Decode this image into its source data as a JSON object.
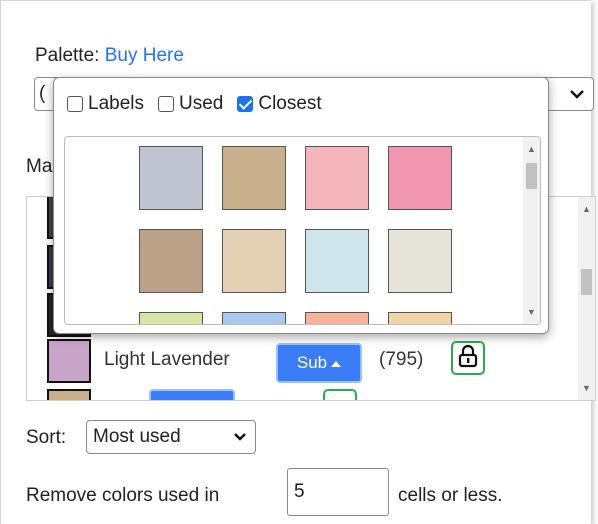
{
  "palette": {
    "label": "Palette:",
    "link_text": "Buy Here",
    "select_value": "("
  },
  "ma_label": "Ma",
  "used_colors": {
    "item": {
      "name": "Light Lavender",
      "sub_label": "Sub",
      "count": "(795)",
      "color": "#c8a4c8"
    },
    "partial_colors": [
      "#c8b08c",
      "#d8c4a6"
    ]
  },
  "sort": {
    "label": "Sort:",
    "value": "Most used"
  },
  "remove": {
    "prefix": "Remove colors used in",
    "value": "5",
    "suffix": "cells or less."
  },
  "popup": {
    "checkboxes": [
      {
        "label": "Labels",
        "checked": false
      },
      {
        "label": "Used",
        "checked": false
      },
      {
        "label": "Closest",
        "checked": true
      }
    ],
    "swatches": [
      {
        "color": "#c0c4d0"
      },
      {
        "color": "#c8b08c"
      },
      {
        "color": "#f4b6bc"
      },
      {
        "color": "#f096b0"
      },
      {
        "color": "#bca088"
      },
      {
        "color": "#e4d0b4"
      },
      {
        "color": "#d0e4ec"
      },
      {
        "color": "#e6e4d8"
      },
      {
        "color": "#d8e4a4"
      },
      {
        "color": "#a8c8ec"
      },
      {
        "color": "#f4b49c"
      },
      {
        "color": "#f0d4a8"
      }
    ]
  },
  "colors": {
    "accent": "#3b7df6",
    "link": "#2a6ff6",
    "lock_border": "#2fa84f",
    "checkbox": "#1a73e8"
  },
  "icons": {
    "lock": "lock-icon",
    "chevron": "chevron-down-icon",
    "caret_up": "caret-up-icon"
  }
}
